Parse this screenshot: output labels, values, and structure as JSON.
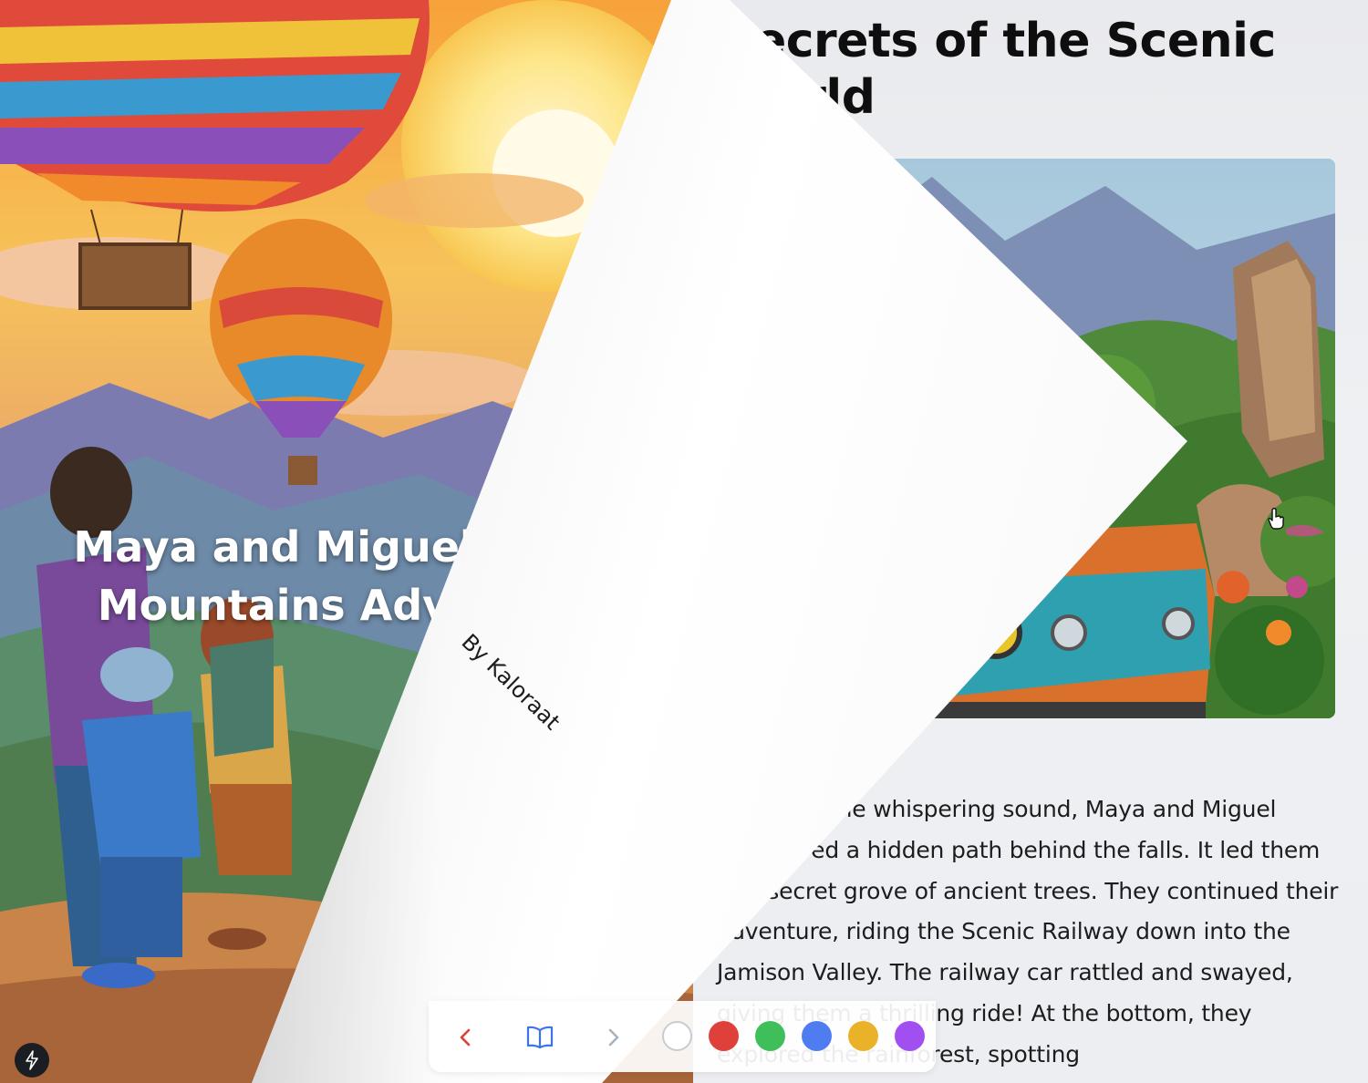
{
  "book": {
    "cover_title_line1": "Maya and Miguel",
    "cover_title_line2": "Mountains Adv",
    "author": "By Kaloraat",
    "page_title_line1": "Secrets of the Scenic",
    "page_title_line2": "World",
    "page_text": "Following the whispering sound, Maya and Miguel discovered a hidden path behind the falls. It led them to a secret grove of ancient trees. They continued their adventure, riding the Scenic Railway down into the Jamison Valley. The railway car rattled and swayed, giving them a thrilling ride! At the bottom, they explored the rainforest, spotting"
  },
  "toolbar": {
    "prev_icon": "chevron-left-icon",
    "book_icon": "open-book-icon",
    "next_icon": "chevron-right-icon",
    "colors": [
      {
        "name": "white",
        "hex": "#ffffff"
      },
      {
        "name": "red",
        "hex": "#e0403a"
      },
      {
        "name": "green",
        "hex": "#3fbf5a"
      },
      {
        "name": "blue",
        "hex": "#4f7cf0"
      },
      {
        "name": "yellow",
        "hex": "#eab229"
      },
      {
        "name": "purple",
        "hex": "#a14ff0"
      }
    ],
    "accent_prev": "#e0403a",
    "accent_book": "#3b74e6",
    "muted_next": "#a9b3bd"
  },
  "floating_button_icon": "lightning-icon"
}
